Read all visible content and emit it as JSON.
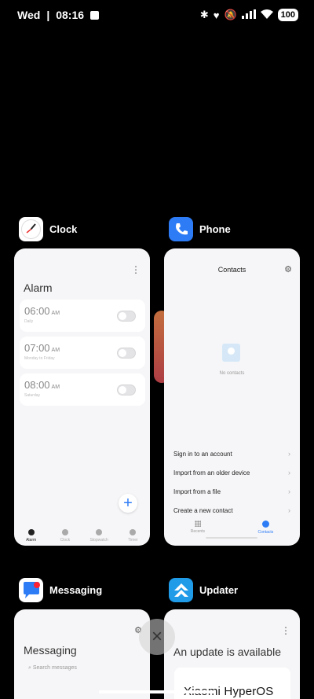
{
  "status_bar": {
    "day": "Wed",
    "separator": "|",
    "time": "08:16",
    "battery": "100"
  },
  "recents": [
    {
      "app_name": "Clock",
      "screen": {
        "title": "Alarm",
        "alarms": [
          {
            "time": "06:00",
            "ampm": "AM",
            "subtitle": "Daily",
            "enabled": false
          },
          {
            "time": "07:00",
            "ampm": "AM",
            "subtitle": "Monday to Friday",
            "enabled": false
          },
          {
            "time": "08:00",
            "ampm": "AM",
            "subtitle": "Saturday",
            "enabled": false
          }
        ],
        "fab": "+",
        "tabs": [
          "Alarm",
          "Clock",
          "Stopwatch",
          "Timer"
        ]
      }
    },
    {
      "app_name": "Phone",
      "screen": {
        "title": "Contacts",
        "empty_text": "No contacts",
        "menu": [
          "Sign in to an account",
          "Import from an older device",
          "Import from a file",
          "Create a new contact"
        ],
        "tabs": [
          "Recents",
          "Contacts"
        ]
      }
    },
    {
      "app_name": "Messaging",
      "screen": {
        "title": "Messaging",
        "search_placeholder": "Search messages"
      }
    },
    {
      "app_name": "Updater",
      "screen": {
        "title": "An update is available",
        "os_name": "Xiaomi HyperOS"
      }
    }
  ],
  "controls": {
    "close_all": "×"
  },
  "colors": {
    "accent": "#2d7cf6",
    "card_bg": "#f6f6f8",
    "background": "#000000"
  }
}
